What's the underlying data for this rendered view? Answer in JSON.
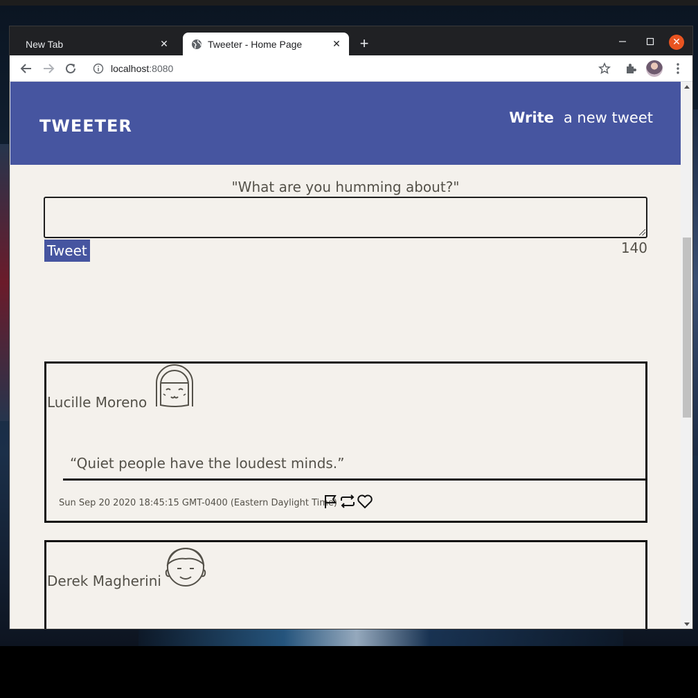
{
  "browser": {
    "tabs": [
      {
        "label": "New Tab",
        "active": false
      },
      {
        "label": "Tweeter - Home Page",
        "active": true
      }
    ],
    "url_host": "localhost",
    "url_port": ":8080"
  },
  "site": {
    "brand": "TWEETER",
    "nav": {
      "write_bold": "Write",
      "write_rest": "a new tweet"
    },
    "accent_color": "#4655a0",
    "background_color": "#f4f1ec"
  },
  "compose": {
    "prompt": "\"What are you humming about?\"",
    "textarea_value": "",
    "tweet_button": "Tweet",
    "char_count": "140"
  },
  "tweets": [
    {
      "author": "Lucille Moreno",
      "avatar": "smiling-girl-avatar-icon",
      "content": "“Quiet people have the loudest minds.”",
      "timestamp": "Sun Sep 20 2020 18:45:15 GMT-0400 (Eastern Daylight Time)",
      "actions": [
        "flag-icon",
        "retweet-icon",
        "heart-icon"
      ]
    },
    {
      "author": "Derek Magherini",
      "avatar": "smiling-boy-avatar-icon",
      "content": "",
      "timestamp": "",
      "actions": []
    }
  ]
}
